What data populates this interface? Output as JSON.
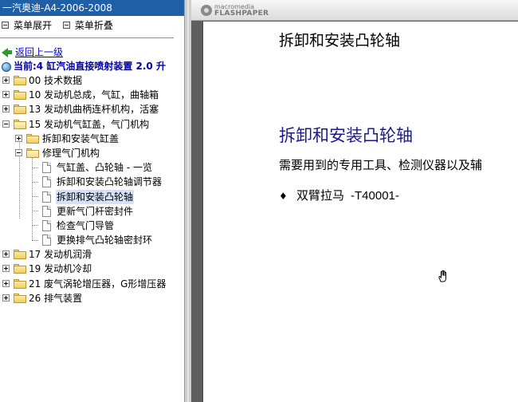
{
  "window": {
    "title": "一汽奥迪-A4-2006-2008"
  },
  "menu": {
    "expand_label": "菜单展开",
    "collapse_label": "菜单折叠"
  },
  "nav": {
    "back_label": "返回上一级",
    "current_label": "当前:4 缸汽油直接喷射装置  2.0 升"
  },
  "tree": {
    "items": [
      {
        "label": "00 技术数据"
      },
      {
        "label": "10 发动机总成，气缸，曲轴箱"
      },
      {
        "label": "13 发动机曲柄连杆机构，活塞"
      },
      {
        "label": "15 发动机气缸盖，气门机构"
      },
      {
        "label": "拆卸和安装气缸盖"
      },
      {
        "label": "修理气门机构"
      },
      {
        "label": "气缸盖、凸轮轴  - 一览"
      },
      {
        "label": "拆卸和安装凸轮轴调节器"
      },
      {
        "label": "拆卸和安装凸轮轴"
      },
      {
        "label": "更新气门杆密封件"
      },
      {
        "label": "检查气门导管"
      },
      {
        "label": "更换排气凸轮轴密封环"
      },
      {
        "label": "17 发动机润滑"
      },
      {
        "label": "19 发动机冷却"
      },
      {
        "label": "21 废气涡轮增压器，G形增压器"
      },
      {
        "label": "26 排气装置"
      }
    ]
  },
  "viewer": {
    "brand_top": "macromedia",
    "brand_bottom": "FLASHPAPER"
  },
  "document": {
    "header": "拆卸和安装凸轮轴",
    "heading": "拆卸和安装凸轮轴",
    "body": "需要用到的专用工具、检测仪器以及辅",
    "bullet_mark": "♦",
    "bullet_text": "双臂拉马",
    "bullet_tool": "-T40001-"
  },
  "colors": {
    "title_bar": "#1f5fa6",
    "heading": "#1a1a8c",
    "selected_bg": "#d4e2f5",
    "link": "#0000cc"
  }
}
